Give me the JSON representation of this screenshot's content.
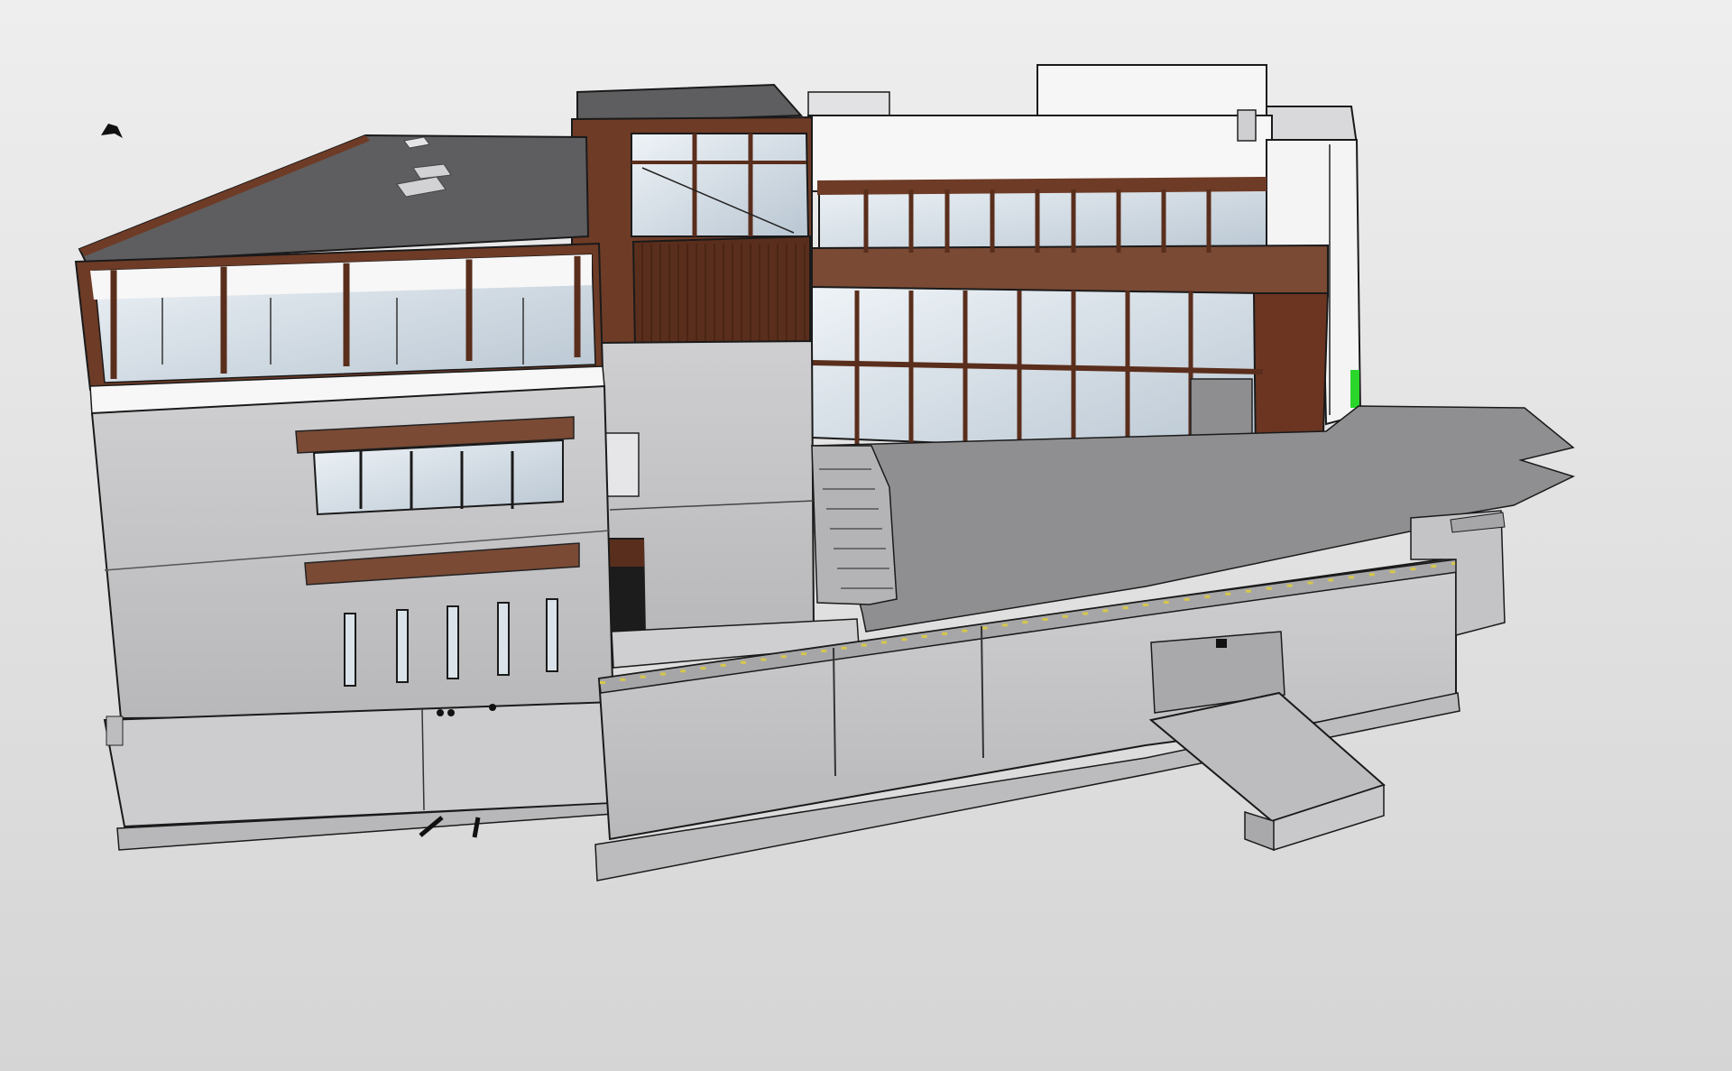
{
  "viewer": {
    "background_top": "#eeeeee",
    "background_bottom": "#d5d5d5"
  },
  "colors": {
    "roof": "#5e5e60",
    "roof_edge": "#6e3b26",
    "wood_dark": "#5a2e1c",
    "wood_light": "#7a4a35",
    "wall_light": "#c9c9cb",
    "wall_mid": "#b6b6b8",
    "wall_white": "#f7f7f7",
    "concrete": "#9c9c9e",
    "concrete_light": "#cdcdcf",
    "glass": "#dbe3ea",
    "glass_dark": "#aab6c2",
    "outline": "#1a1a1a",
    "railing_yellow": "#d6c74a",
    "accent_green": "#2bd62b"
  },
  "model": {
    "name_icon": "building-3d-model",
    "parts": [
      "left-wing",
      "stair-tower",
      "right-wing",
      "upper-white-block",
      "terrace",
      "ramp"
    ]
  }
}
